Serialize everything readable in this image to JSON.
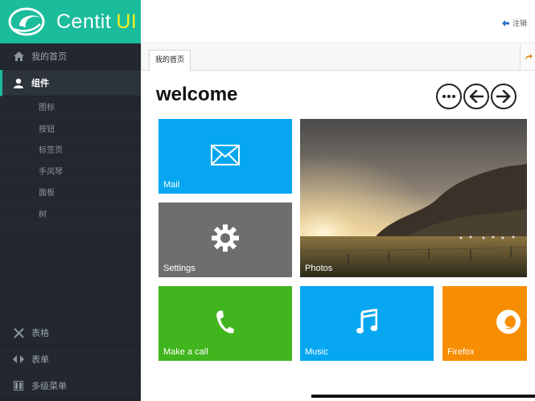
{
  "brand": {
    "name": "Centit",
    "suffix": "UI",
    "bg_color": "#1abc9c",
    "suffix_color": "#f5f01e"
  },
  "sidebar": {
    "items": [
      {
        "label": "我的首页",
        "icon": "home-icon"
      },
      {
        "label": "组件",
        "icon": "user-icon",
        "active": true
      }
    ],
    "sub_items": [
      "图标",
      "按钮",
      "标签页",
      "手风琴",
      "面板",
      "树"
    ],
    "bottom_items": [
      {
        "label": "表格",
        "icon": "wrench-icon"
      },
      {
        "label": "表单",
        "icon": "arrows-icon"
      },
      {
        "label": "多级菜单",
        "icon": "columns-icon"
      }
    ]
  },
  "topbar": {
    "logout_label": "注销",
    "logout_icon": "logout-icon"
  },
  "tabs": [
    {
      "label": "我的首页"
    }
  ],
  "content": {
    "title": "welcome",
    "nav_buttons": [
      "more-icon",
      "arrow-left-icon",
      "arrow-right-icon"
    ],
    "tiles": [
      {
        "label": "Mail",
        "color": "#06a7f0",
        "icon": "mail-icon"
      },
      {
        "label": "Settings",
        "color": "#6e6e6e",
        "icon": "gear-icon"
      },
      {
        "label": "Photos",
        "color": "#3a3226",
        "icon": "landscape-photo"
      },
      {
        "label": "Make a call",
        "color": "#41b51e",
        "icon": "phone-icon"
      },
      {
        "label": "Music",
        "color": "#06a7f0",
        "icon": "music-icon"
      },
      {
        "label": "Firefox",
        "color": "#f78d00",
        "icon": "firefox-icon"
      }
    ]
  }
}
